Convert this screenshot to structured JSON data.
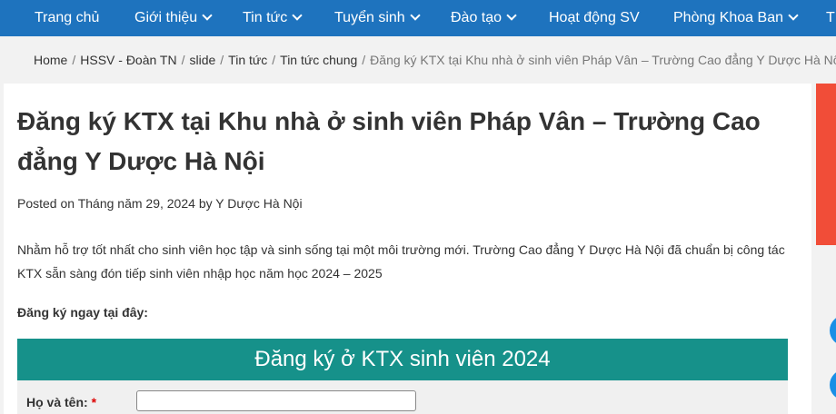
{
  "nav": {
    "items": [
      {
        "label": "Trang chủ",
        "has_dropdown": false
      },
      {
        "label": "Giới thiệu",
        "has_dropdown": true
      },
      {
        "label": "Tin tức",
        "has_dropdown": true
      },
      {
        "label": "Tuyển sinh",
        "has_dropdown": true
      },
      {
        "label": "Đào tạo",
        "has_dropdown": true
      },
      {
        "label": "Hoạt động SV",
        "has_dropdown": false
      },
      {
        "label": "Phòng Khoa Ban",
        "has_dropdown": true
      },
      {
        "label": "T",
        "has_dropdown": false
      }
    ]
  },
  "breadcrumb": {
    "links": [
      "Home",
      "HSSV - Đoàn TN",
      "slide",
      "Tin tức",
      "Tin tức chung"
    ],
    "separator": "/",
    "current": "Đăng ký KTX tại Khu nhà ở sinh viên Pháp Vân – Trường Cao đẳng Y Dược Hà Nội"
  },
  "article": {
    "title": "Đăng ký KTX tại Khu nhà ở sinh viên Pháp Vân – Trường Cao đẳng Y Dược Hà Nội",
    "posted_prefix": "Posted on",
    "date": "Tháng năm 29, 2024",
    "by_text": "by",
    "author": "Y Dược Hà Nội",
    "intro": "Nhằm hỗ trợ tốt nhất cho sinh viên học tập và sinh sống tại một môi trường mới. Trường Cao đẳng Y Dược Hà Nội đã chuẩn bị công tác KTX sẵn sàng đón tiếp sinh viên nhập học năm học 2024 – 2025",
    "cta": "Đăng ký ngay tại đây:"
  },
  "form": {
    "header": "Đăng ký ở KTX sinh viên 2024",
    "name_label": "Họ và tên:",
    "required_mark": "*",
    "name_value": ""
  },
  "colors": {
    "nav_bg": "#1e73be",
    "form_header_bg": "#16918a",
    "side_bar": "#f14d38",
    "float_button": "#1a8fe6"
  }
}
